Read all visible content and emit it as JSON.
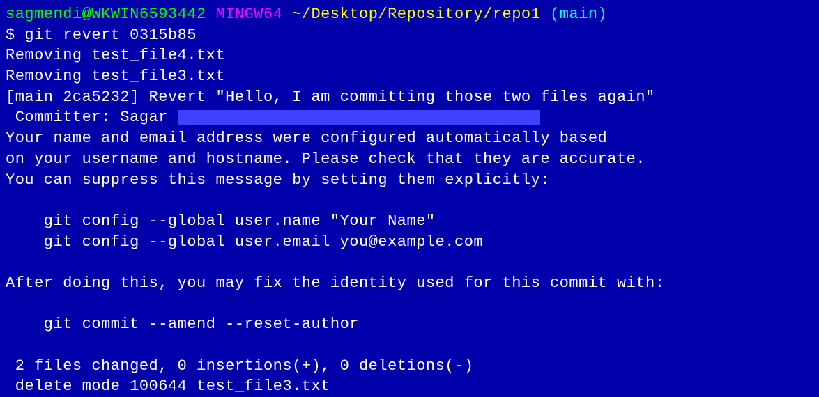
{
  "prompt": {
    "user_host": "sagmendi@WKWIN6593442",
    "shell": "MINGW64",
    "path": "~/Desktop/Repository/repo1",
    "branch": "(main)"
  },
  "command": "$ git revert 0315b85",
  "lines": {
    "l1": "Removing test_file4.txt",
    "l2": "Removing test_file3.txt",
    "l3": "[main 2ca5232] Revert \"Hello, I am committing those two files again\"",
    "committer_prefix": " Committer: Sagar ",
    "l5": "Your name and email address were configured automatically based",
    "l6": "on your username and hostname. Please check that they are accurate.",
    "l7": "You can suppress this message by setting them explicitly:",
    "l8": "",
    "l9": "    git config --global user.name \"Your Name\"",
    "l10": "    git config --global user.email you@example.com",
    "l11": "",
    "l12": "After doing this, you may fix the identity used for this commit with:",
    "l13": "",
    "l14": "    git commit --amend --reset-author",
    "l15": "",
    "l16": " 2 files changed, 0 insertions(+), 0 deletions(-)",
    "l17": " delete mode 100644 test_file3.txt"
  }
}
